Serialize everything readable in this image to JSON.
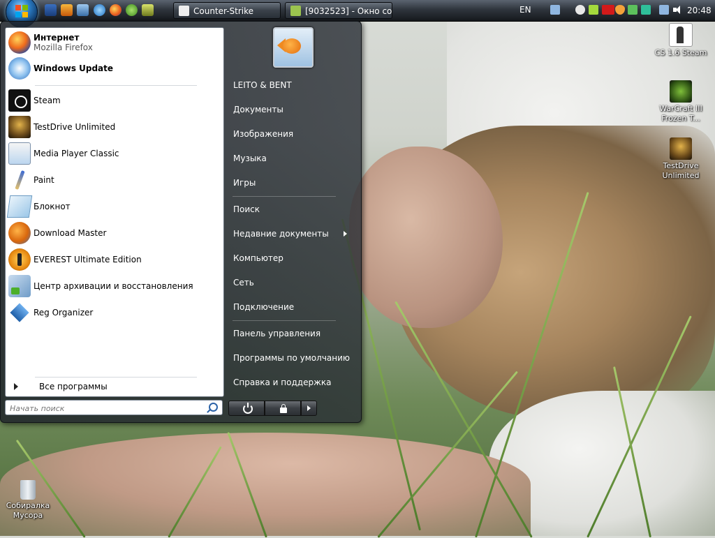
{
  "taskbar": {
    "quick_launch": [
      "show-desktop-icon",
      "winamp-icon",
      "desktop-icon",
      "internet-explorer-icon",
      "firefox-icon",
      "utorrent-icon",
      "media-icon"
    ],
    "tasks": [
      {
        "label": "Counter-Strike"
      },
      {
        "label": "[9032523] - Окно со..."
      }
    ],
    "language": "EN",
    "tray_icons": [
      "network-icon",
      "steam-icon",
      "android-icon",
      "ati-icon",
      "shield-icon",
      "app-icon",
      "monitor-icon",
      "volume-icon"
    ],
    "clock": "20:48"
  },
  "start_menu": {
    "pinned": [
      {
        "title": "Интернет",
        "subtitle": "Mozilla Firefox",
        "icon": "firefox-icon"
      },
      {
        "title": "Windows Update",
        "icon": "windows-update-icon"
      }
    ],
    "recent": [
      {
        "label": "Steam",
        "icon": "steam-icon"
      },
      {
        "label": "TestDrive Unlimited",
        "icon": "testdrive-icon"
      },
      {
        "label": "Media Player Classic",
        "icon": "media-player-classic-icon"
      },
      {
        "label": "Paint",
        "icon": "paint-icon"
      },
      {
        "label": "Блокнот",
        "icon": "notepad-icon"
      },
      {
        "label": "Download Master",
        "icon": "download-master-icon"
      },
      {
        "label": "EVEREST Ultimate Edition",
        "icon": "everest-icon"
      },
      {
        "label": "Центр архивации и восстановления",
        "icon": "backup-center-icon"
      },
      {
        "label": "Reg Organizer",
        "icon": "reg-organizer-icon"
      }
    ],
    "all_programs": "Все программы",
    "search_placeholder": "Начать поиск",
    "right": [
      {
        "label": "LEITO & BENT"
      },
      {
        "label": "Документы"
      },
      {
        "label": "Изображения"
      },
      {
        "label": "Музыка"
      },
      {
        "label": "Игры"
      },
      {
        "label": "Поиск"
      },
      {
        "label": "Недавние документы",
        "has_submenu": true
      },
      {
        "label": "Компьютер"
      },
      {
        "label": "Сеть"
      },
      {
        "label": "Подключение"
      },
      {
        "label": "Панель управления"
      },
      {
        "label": "Программы по умолчанию"
      },
      {
        "label": "Справка и поддержка"
      }
    ]
  },
  "desktop_icons": [
    {
      "label": "CS 1.6 Steam",
      "icon": "counter-strike-icon"
    },
    {
      "label": "WarCraft III Frozen T...",
      "icon": "warcraft-icon"
    },
    {
      "label": "TestDrive Unlimited",
      "icon": "testdrive-icon"
    },
    {
      "label": "Собиралка Мусора",
      "icon": "recycle-bin-icon"
    }
  ],
  "colors": {
    "accent": "#2c7fc8",
    "taskbar": "#2f353d",
    "menu_white": "#ffffff"
  }
}
